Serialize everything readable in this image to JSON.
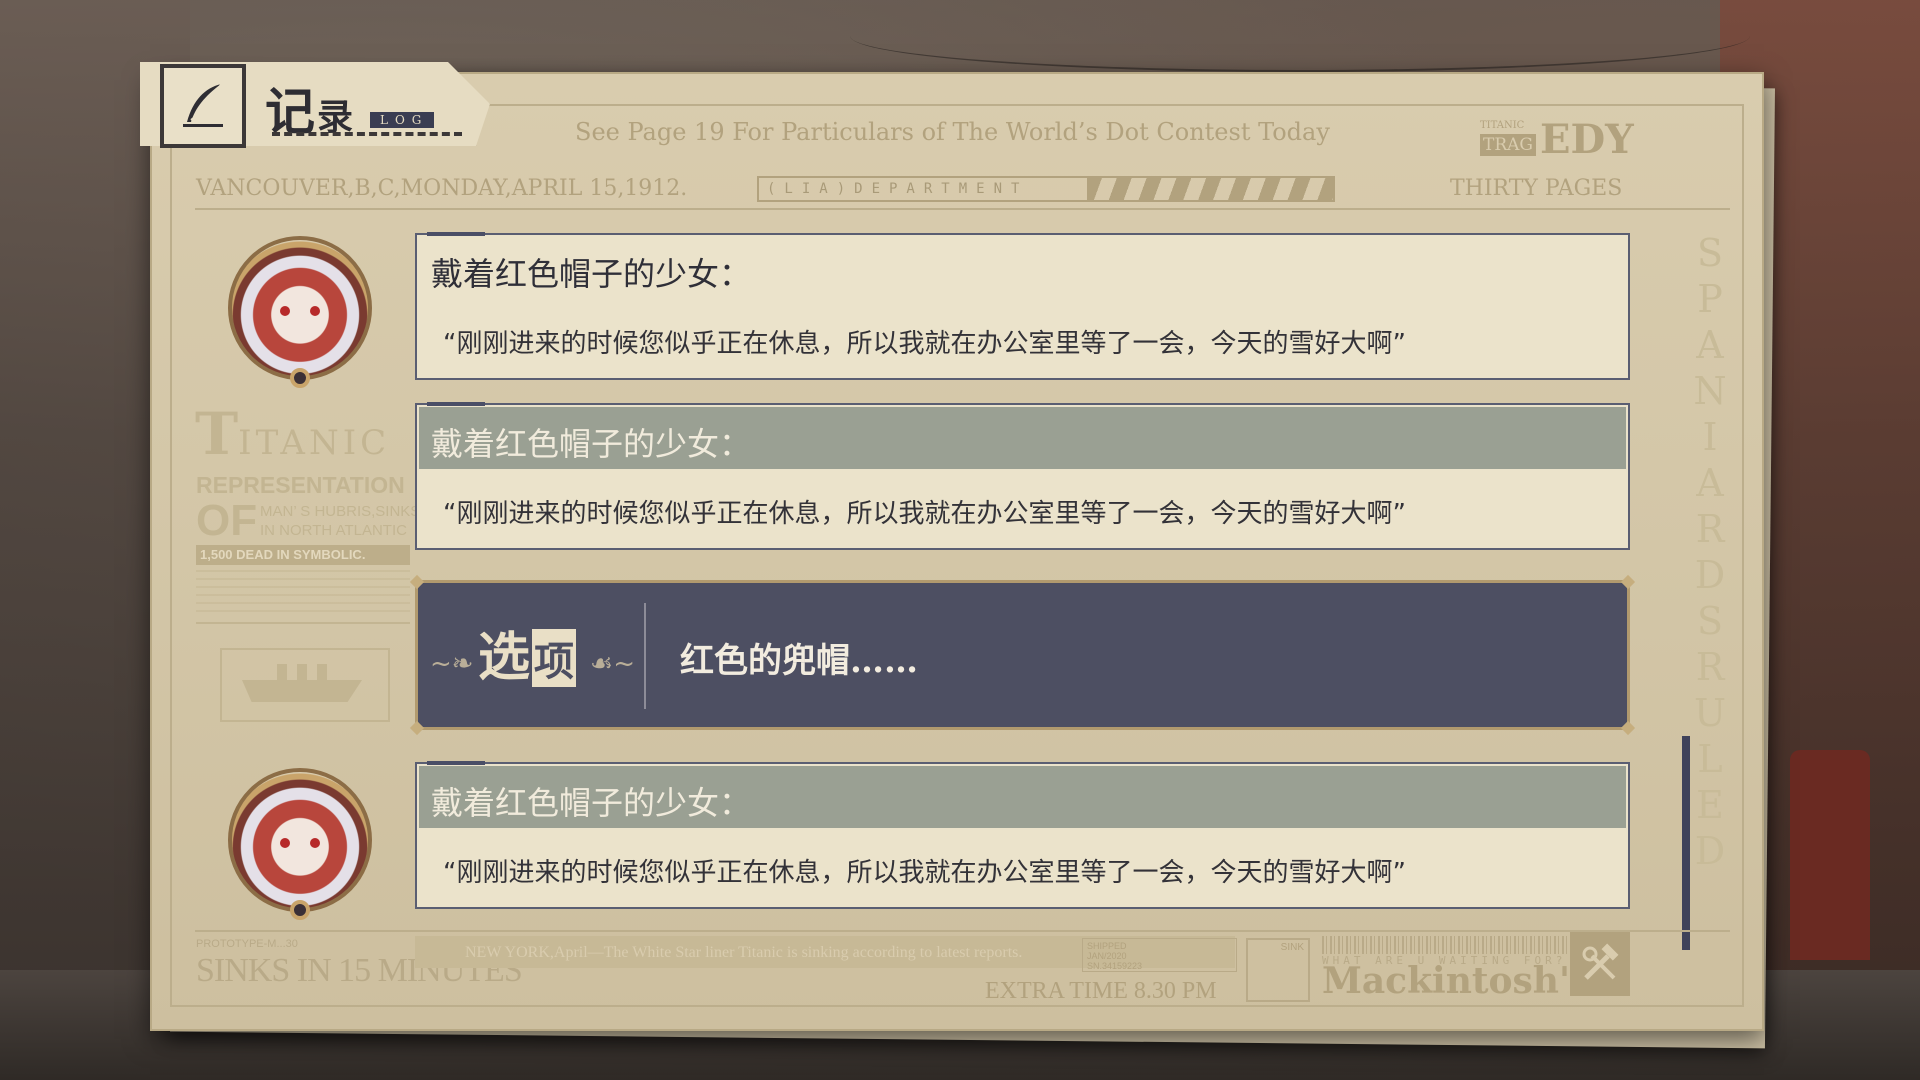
{
  "header": {
    "title_big": "记",
    "title_small": "录",
    "log_badge": "LOG",
    "headline": "See Page 19 For Particulars of The World’s Dot Contest Today",
    "titanic_small": "TITANIC",
    "trag": "TRAG",
    "edy": "EDY",
    "dateline": "VANCOUVER,B,C,MONDAY,APRIL 15,1912.",
    "department": "(LIA)DEPARTMENT",
    "pages": "THIRTY PAGES"
  },
  "side": {
    "titanic_first": "T",
    "titanic_rest": "ITANIC",
    "representation": "REPRESENTATION",
    "of": "OF",
    "of_sub_1": "MAN’ S HUBRIS,SINKS",
    "of_sub_2": "IN NORTH ATLANTIC",
    "dead": "1,500 DEAD IN SYMBOLIC.",
    "vertical": "SPANIARDS RULED"
  },
  "entries": [
    {
      "speaker": "戴着红色帽子的少女：",
      "line": "“刚刚进来的时候您似乎正在休息，所以我就在办公室里等了一会，今天的雪好大啊”"
    },
    {
      "speaker": "戴着红色帽子的少女：",
      "line": "“刚刚进来的时候您似乎正在休息，所以我就在办公室里等了一会，今天的雪好大啊”"
    },
    {
      "speaker": "戴着红色帽子的少女：",
      "line": "“刚刚进来的时候您似乎正在休息，所以我就在办公室里等了一会，今天的雪好大啊”"
    }
  ],
  "choice": {
    "label_1": "选",
    "label_2": "项",
    "text": "红色的兜帽……"
  },
  "footer": {
    "proto": "PROTOTYPE-M...30",
    "sinks": "SINKS IN 15 MINUTES",
    "news": "NEW YORK,April—The White Star liner Titanic is sinking according to latest reports.",
    "shipped_1": "SHIPPED",
    "shipped_2": "JAN/2020",
    "shipped_3": "SN.34159223",
    "extra": "EXTRA TIME 8.30 PM",
    "sink": "SINK",
    "waiting": "WHAT ARE U WAITING FOR?",
    "mackintosh": "Mackintosh's"
  },
  "colors": {
    "paper": "#d6c9aa",
    "entry_bg": "#ebe3cb",
    "highlight_bar": "#9aa093",
    "choice_bg": "#4d4f62",
    "accent": "#3f425a"
  },
  "icons": {
    "header": "quill-icon",
    "tools": "hammer-wrench-icon"
  }
}
